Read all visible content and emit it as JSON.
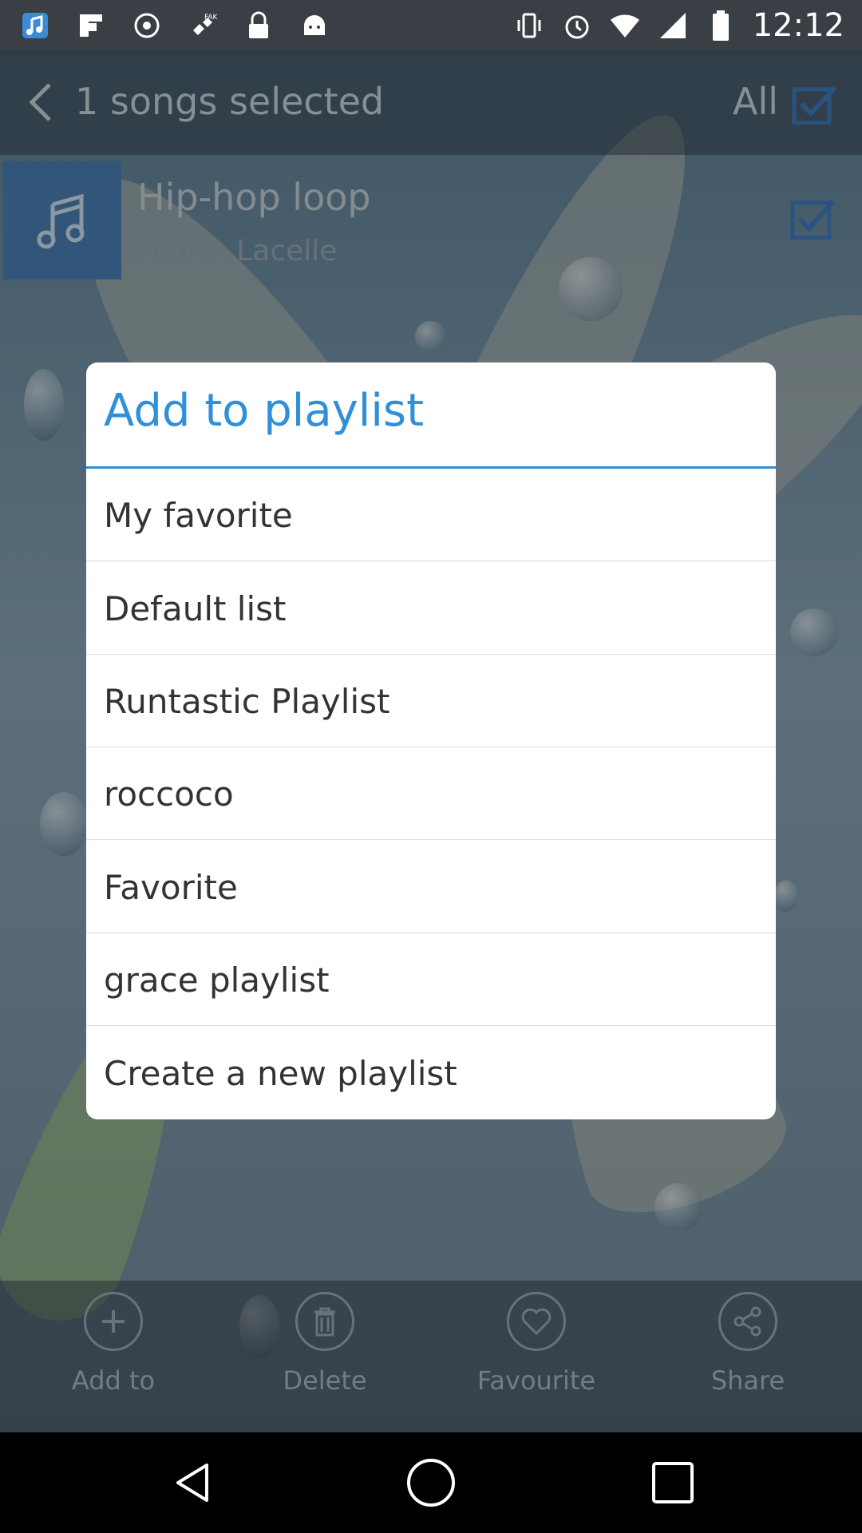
{
  "status_bar": {
    "time": "12:12",
    "icons_left": [
      "music-note-icon",
      "flipboard-icon",
      "sync-icon",
      "satellite-icon",
      "lock-icon",
      "android-icon"
    ],
    "icons_right": [
      "vibrate-icon",
      "alarm-icon",
      "wifi-icon",
      "signal-icon",
      "battery-icon"
    ]
  },
  "header": {
    "title": "1 songs selected",
    "all_label": "All"
  },
  "song": {
    "title": "Hip-hop loop",
    "artist": "Simon Lacelle",
    "selected": true
  },
  "dialog": {
    "title": "Add to playlist",
    "items": [
      {
        "label": "My favorite"
      },
      {
        "label": "Default list"
      },
      {
        "label": "Runtastic Playlist"
      },
      {
        "label": "roccoco"
      },
      {
        "label": "Favorite"
      },
      {
        "label": "grace playlist"
      },
      {
        "label": "Create a new playlist"
      }
    ]
  },
  "bottom_actions": [
    {
      "label": "Add to",
      "icon": "plus-icon"
    },
    {
      "label": "Delete",
      "icon": "trash-icon"
    },
    {
      "label": "Favourite",
      "icon": "heart-icon"
    },
    {
      "label": "Share",
      "icon": "share-icon"
    }
  ],
  "colors": {
    "accent": "#2f8fd8",
    "album_art": "#4a7fb4",
    "text_dark": "#333333"
  }
}
